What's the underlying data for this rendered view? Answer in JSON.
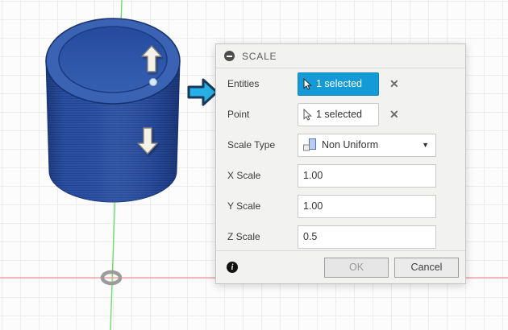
{
  "dialog": {
    "title": "SCALE",
    "entities_label": "Entities",
    "entities_value": "1 selected",
    "point_label": "Point",
    "point_value": "1 selected",
    "scale_type_label": "Scale Type",
    "scale_type_value": "Non Uniform",
    "x_scale_label": "X Scale",
    "x_scale_value": "1.00",
    "y_scale_label": "Y Scale",
    "y_scale_value": "1.00",
    "z_scale_label": "0.5",
    "z_scale_label_text": "Z Scale",
    "z_scale_value": "0.5",
    "ok_label": "OK",
    "cancel_label": "Cancel"
  },
  "icons": {
    "close": "✕",
    "dropdown_caret": "▼",
    "info": "i"
  },
  "colors": {
    "selection_blue": "#149bd7",
    "model_blue": "#2b51a7",
    "axis_green": "#6edb6e",
    "axis_red": "#f19090",
    "dialog_bg": "#f2f2f1"
  }
}
